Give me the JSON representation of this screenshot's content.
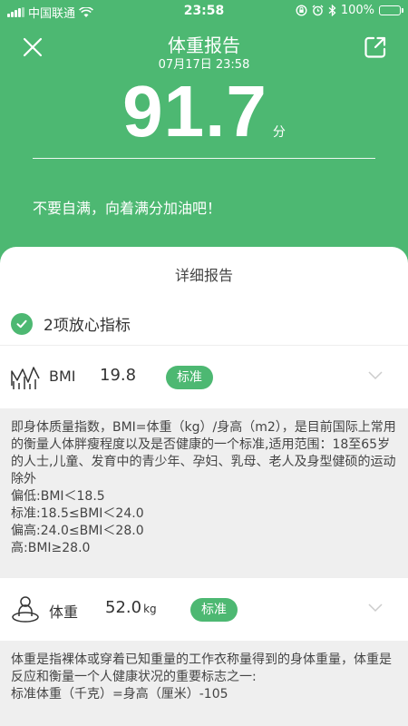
{
  "status_bar": {
    "carrier": "中国联通",
    "time": "23:58",
    "battery": "100%",
    "battery_level": 1.0
  },
  "header": {
    "title": "体重报告",
    "date": "07月17日 23:58",
    "score": "91.7",
    "score_unit": "分",
    "message": "不要自满，向着满分加油吧！"
  },
  "report": {
    "title": "详细报告",
    "summary": "2项放心指标",
    "items": [
      {
        "icon": "bmi-chart-icon",
        "name": "BMI",
        "value": "19.8",
        "unit": "",
        "status": "标准",
        "description": [
          "即身体质量指数，BMI=体重（kg）/身高（m2），是目前国际上常用的衡量人体胖瘦程度以及是否健康的一个标准,适用范围：18至65岁的人士,儿童、发育中的青少年、孕妇、乳母、老人及身型健硕的运动除外",
          "偏低:BMI＜18.5",
          "标准:18.5≤BMI＜24.0",
          "偏高:24.0≤BMI＜28.0",
          "高:BMI≥28.0"
        ]
      },
      {
        "icon": "scale-person-icon",
        "name": "体重",
        "value": "52.0",
        "unit": "kg",
        "status": "标准",
        "description": [
          "体重是指裸体或穿着已知重量的工作衣称量得到的身体重量，体重是反应和衡量一个人健康状况的重要标志之一:",
          "标准体重（千克）=身高（厘米）-105"
        ]
      }
    ]
  },
  "colors": {
    "brand_green": "#4db872",
    "description_bg": "#efefef"
  }
}
